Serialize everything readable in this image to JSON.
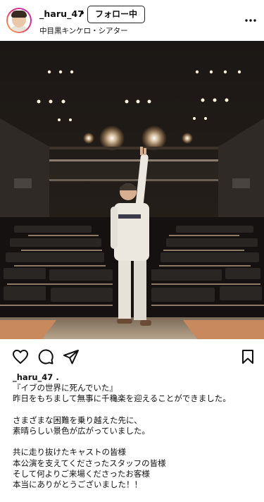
{
  "post": {
    "username": "_haru_47",
    "separator": "•",
    "follow_label": "フォロー中",
    "location": "中目黒キンケロ・シアター"
  },
  "icons": {
    "more": "more-horizontal-icon",
    "like": "heart-icon",
    "comment": "comment-icon",
    "share": "send-icon",
    "save": "bookmark-icon"
  },
  "caption": {
    "username": "_haru_47 .",
    "lines": [
      "『イブの世界に死んでいた』",
      "昨日をもちまして無事に千穐楽を迎えることができました。",
      "",
      "さまざまな困難を乗り越えた先に、",
      "素晴らしい景色が広がっていました。",
      "",
      "共に走り抜けたキャストの皆様",
      "本公演を支えてくださったスタッフの皆様",
      "そして何よりご来場くださったお客様",
      "本当にありがとうございました！！"
    ]
  },
  "colors": {
    "ring_start": "#f9c24a",
    "ring_mid": "#e1306c",
    "ring_end": "#b32fc2",
    "text": "#111111"
  }
}
